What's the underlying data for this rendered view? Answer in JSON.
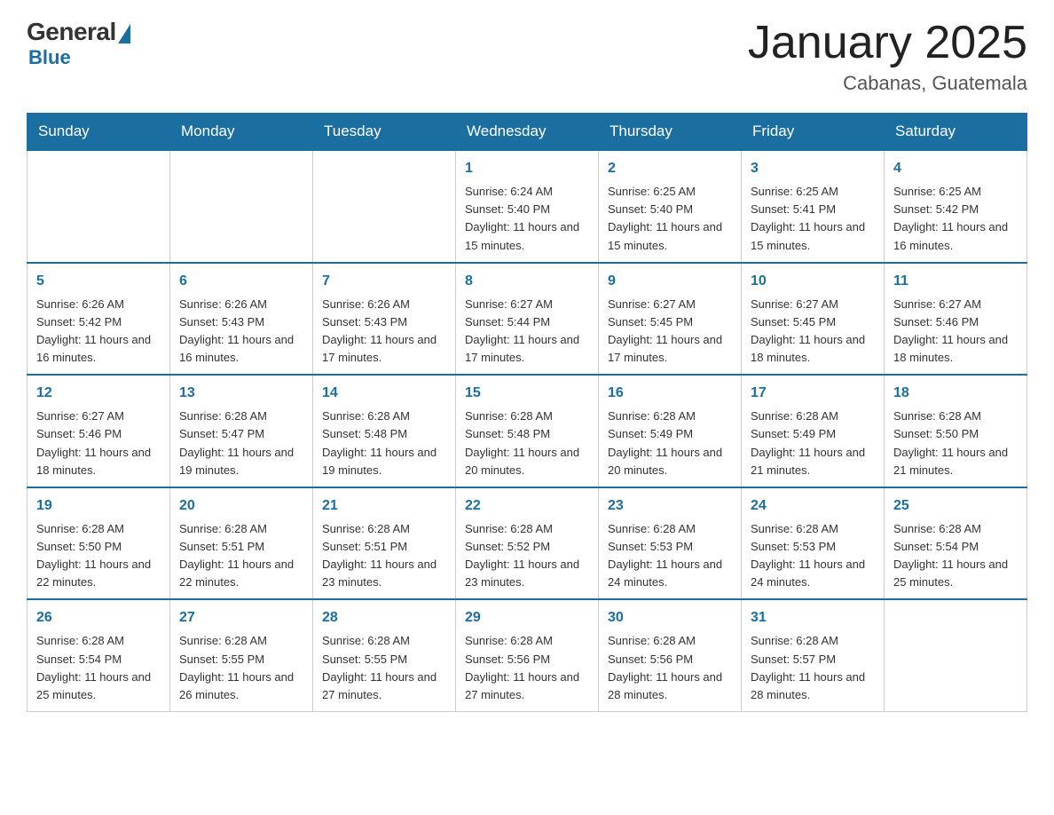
{
  "logo": {
    "general": "General",
    "blue": "Blue"
  },
  "title": "January 2025",
  "location": "Cabanas, Guatemala",
  "days_of_week": [
    "Sunday",
    "Monday",
    "Tuesday",
    "Wednesday",
    "Thursday",
    "Friday",
    "Saturday"
  ],
  "weeks": [
    [
      {
        "day": "",
        "info": ""
      },
      {
        "day": "",
        "info": ""
      },
      {
        "day": "",
        "info": ""
      },
      {
        "day": "1",
        "info": "Sunrise: 6:24 AM\nSunset: 5:40 PM\nDaylight: 11 hours and 15 minutes."
      },
      {
        "day": "2",
        "info": "Sunrise: 6:25 AM\nSunset: 5:40 PM\nDaylight: 11 hours and 15 minutes."
      },
      {
        "day": "3",
        "info": "Sunrise: 6:25 AM\nSunset: 5:41 PM\nDaylight: 11 hours and 15 minutes."
      },
      {
        "day": "4",
        "info": "Sunrise: 6:25 AM\nSunset: 5:42 PM\nDaylight: 11 hours and 16 minutes."
      }
    ],
    [
      {
        "day": "5",
        "info": "Sunrise: 6:26 AM\nSunset: 5:42 PM\nDaylight: 11 hours and 16 minutes."
      },
      {
        "day": "6",
        "info": "Sunrise: 6:26 AM\nSunset: 5:43 PM\nDaylight: 11 hours and 16 minutes."
      },
      {
        "day": "7",
        "info": "Sunrise: 6:26 AM\nSunset: 5:43 PM\nDaylight: 11 hours and 17 minutes."
      },
      {
        "day": "8",
        "info": "Sunrise: 6:27 AM\nSunset: 5:44 PM\nDaylight: 11 hours and 17 minutes."
      },
      {
        "day": "9",
        "info": "Sunrise: 6:27 AM\nSunset: 5:45 PM\nDaylight: 11 hours and 17 minutes."
      },
      {
        "day": "10",
        "info": "Sunrise: 6:27 AM\nSunset: 5:45 PM\nDaylight: 11 hours and 18 minutes."
      },
      {
        "day": "11",
        "info": "Sunrise: 6:27 AM\nSunset: 5:46 PM\nDaylight: 11 hours and 18 minutes."
      }
    ],
    [
      {
        "day": "12",
        "info": "Sunrise: 6:27 AM\nSunset: 5:46 PM\nDaylight: 11 hours and 18 minutes."
      },
      {
        "day": "13",
        "info": "Sunrise: 6:28 AM\nSunset: 5:47 PM\nDaylight: 11 hours and 19 minutes."
      },
      {
        "day": "14",
        "info": "Sunrise: 6:28 AM\nSunset: 5:48 PM\nDaylight: 11 hours and 19 minutes."
      },
      {
        "day": "15",
        "info": "Sunrise: 6:28 AM\nSunset: 5:48 PM\nDaylight: 11 hours and 20 minutes."
      },
      {
        "day": "16",
        "info": "Sunrise: 6:28 AM\nSunset: 5:49 PM\nDaylight: 11 hours and 20 minutes."
      },
      {
        "day": "17",
        "info": "Sunrise: 6:28 AM\nSunset: 5:49 PM\nDaylight: 11 hours and 21 minutes."
      },
      {
        "day": "18",
        "info": "Sunrise: 6:28 AM\nSunset: 5:50 PM\nDaylight: 11 hours and 21 minutes."
      }
    ],
    [
      {
        "day": "19",
        "info": "Sunrise: 6:28 AM\nSunset: 5:50 PM\nDaylight: 11 hours and 22 minutes."
      },
      {
        "day": "20",
        "info": "Sunrise: 6:28 AM\nSunset: 5:51 PM\nDaylight: 11 hours and 22 minutes."
      },
      {
        "day": "21",
        "info": "Sunrise: 6:28 AM\nSunset: 5:51 PM\nDaylight: 11 hours and 23 minutes."
      },
      {
        "day": "22",
        "info": "Sunrise: 6:28 AM\nSunset: 5:52 PM\nDaylight: 11 hours and 23 minutes."
      },
      {
        "day": "23",
        "info": "Sunrise: 6:28 AM\nSunset: 5:53 PM\nDaylight: 11 hours and 24 minutes."
      },
      {
        "day": "24",
        "info": "Sunrise: 6:28 AM\nSunset: 5:53 PM\nDaylight: 11 hours and 24 minutes."
      },
      {
        "day": "25",
        "info": "Sunrise: 6:28 AM\nSunset: 5:54 PM\nDaylight: 11 hours and 25 minutes."
      }
    ],
    [
      {
        "day": "26",
        "info": "Sunrise: 6:28 AM\nSunset: 5:54 PM\nDaylight: 11 hours and 25 minutes."
      },
      {
        "day": "27",
        "info": "Sunrise: 6:28 AM\nSunset: 5:55 PM\nDaylight: 11 hours and 26 minutes."
      },
      {
        "day": "28",
        "info": "Sunrise: 6:28 AM\nSunset: 5:55 PM\nDaylight: 11 hours and 27 minutes."
      },
      {
        "day": "29",
        "info": "Sunrise: 6:28 AM\nSunset: 5:56 PM\nDaylight: 11 hours and 27 minutes."
      },
      {
        "day": "30",
        "info": "Sunrise: 6:28 AM\nSunset: 5:56 PM\nDaylight: 11 hours and 28 minutes."
      },
      {
        "day": "31",
        "info": "Sunrise: 6:28 AM\nSunset: 5:57 PM\nDaylight: 11 hours and 28 minutes."
      },
      {
        "day": "",
        "info": ""
      }
    ]
  ]
}
